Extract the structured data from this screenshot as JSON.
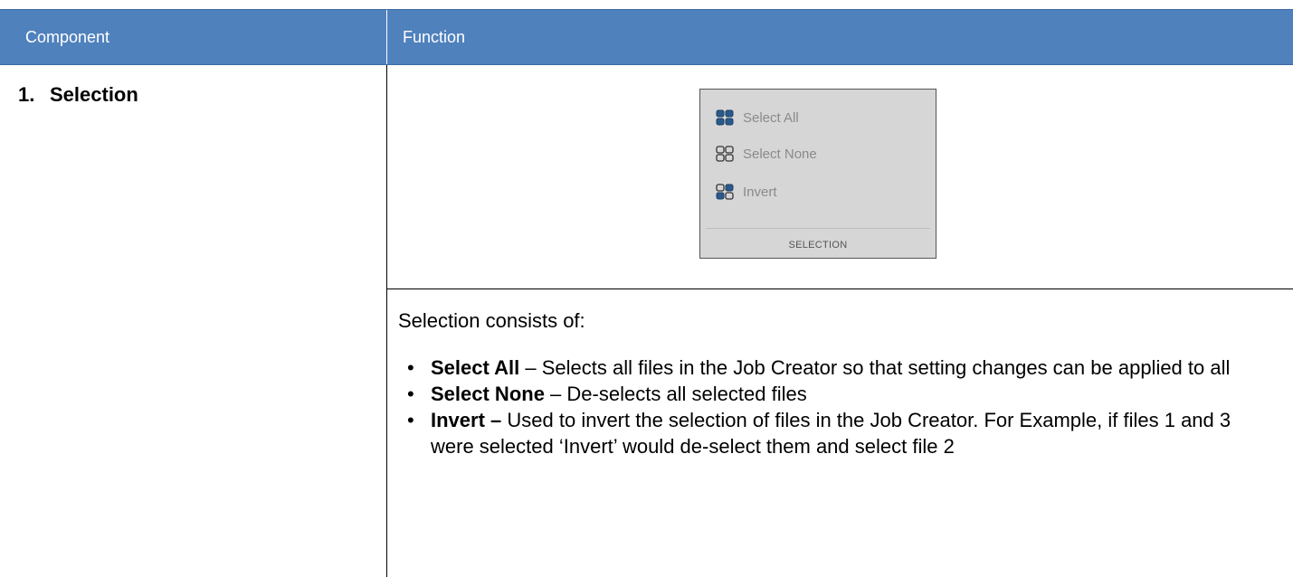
{
  "header": {
    "col1": "Component",
    "col2": "Function"
  },
  "component": {
    "number": "1.",
    "name": "Selection"
  },
  "ribbon": {
    "items": [
      {
        "label": "Select All",
        "icon": "select-all-icon"
      },
      {
        "label": "Select None",
        "icon": "select-none-icon"
      },
      {
        "label": "Invert",
        "icon": "invert-icon"
      }
    ],
    "caption": "SELECTION"
  },
  "description": {
    "intro": "Selection consists of:",
    "bullets": [
      {
        "term": "Select All",
        "sep": " – ",
        "text": "Selects all files in the Job Creator so that setting changes can be applied to all"
      },
      {
        "term": "Select None",
        "sep": " – ",
        "text": "De-selects all selected files"
      },
      {
        "term": "Invert –",
        "sep": " ",
        "text": "Used to invert the selection of files in the Job Creator. For Example, if files 1 and 3 were selected ‘Invert’ would de-select them and select file 2"
      }
    ]
  },
  "colors": {
    "header_bg": "#4f81bd",
    "ribbon_bg": "#d6d6d6",
    "icon_blue": "#2a5a8c"
  }
}
